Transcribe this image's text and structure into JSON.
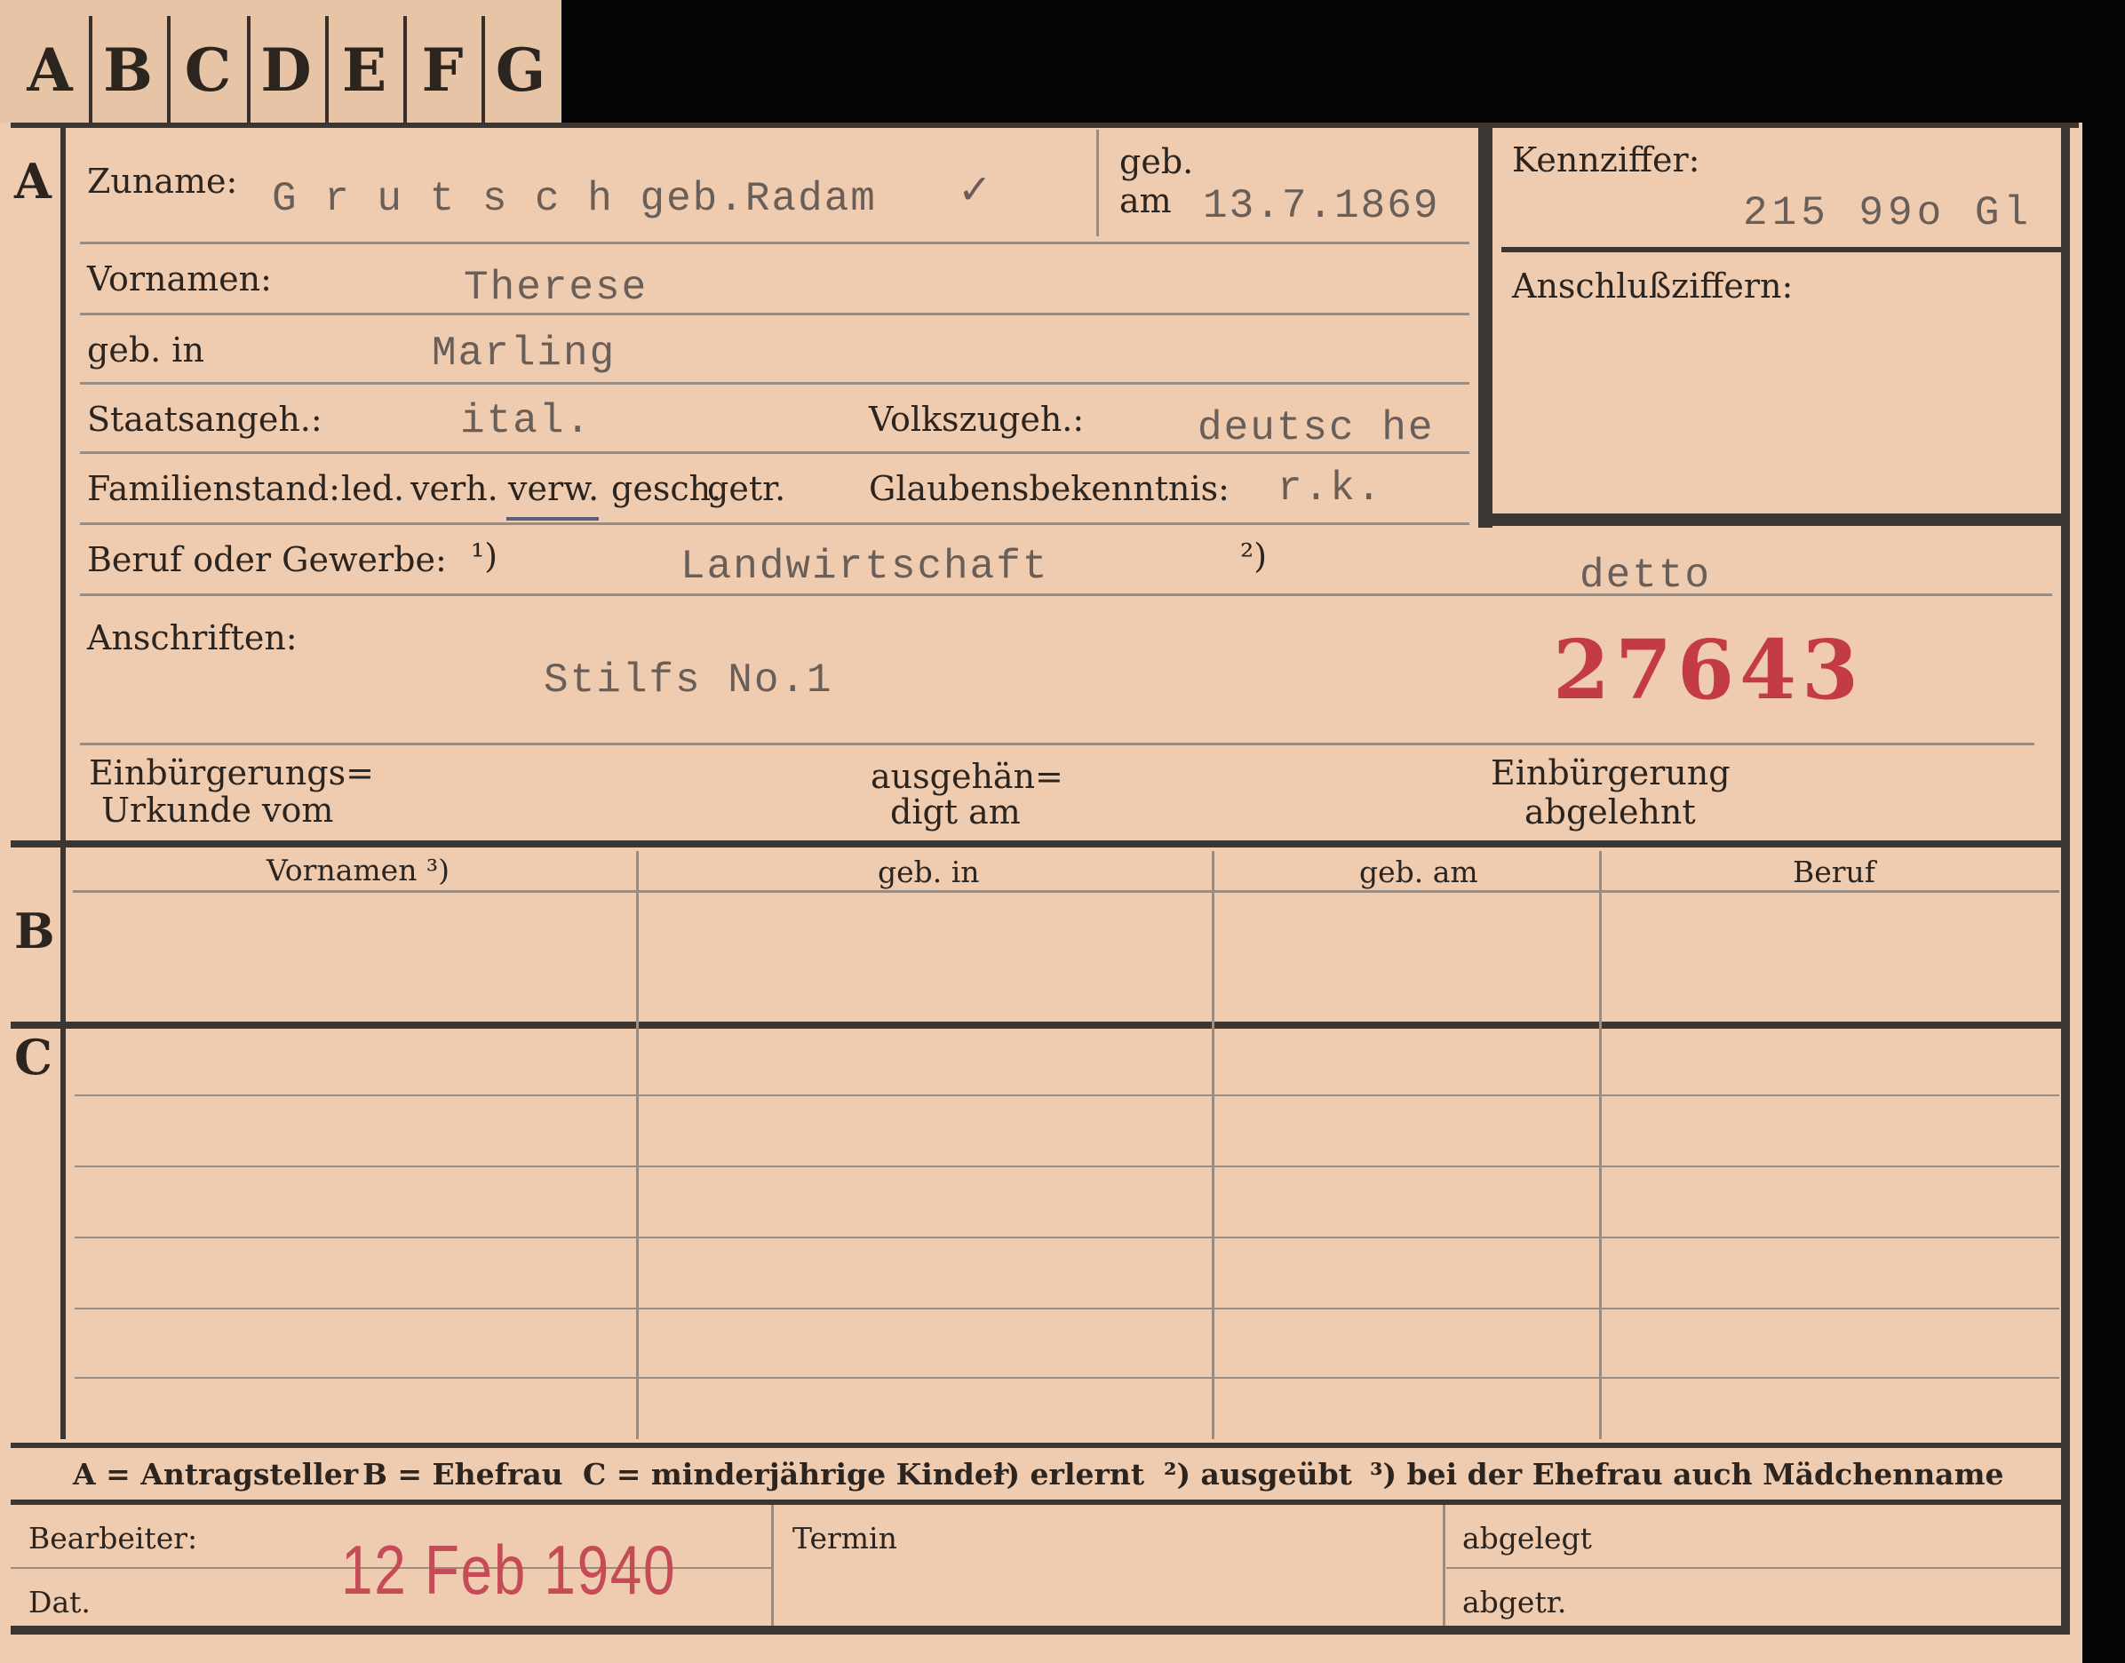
{
  "tabs": [
    "A",
    "B",
    "C",
    "D",
    "E",
    "F",
    "G"
  ],
  "sections": {
    "a": "A",
    "b": "B",
    "c": "C"
  },
  "labels": {
    "zuname": "Zuname:",
    "geb_am_1": "geb.",
    "geb_am_2": "am",
    "vornamen": "Vornamen:",
    "geb_in": "geb. in",
    "staatsangeh": "Staatsangeh.:",
    "volkszugeh": "Volkszugeh.:",
    "familienstand": "Familienstand:",
    "familienstand_options": [
      "led.",
      "verh.",
      "verw.",
      "gesch.",
      "getr."
    ],
    "glaubensbekenntnis": "Glaubensbekenntnis:",
    "beruf": "Beruf oder Gewerbe:",
    "beruf_note1": "¹)",
    "beruf_note2": "²)",
    "anschriften": "Anschriften:",
    "einb_1": "Einbürgerungs=",
    "einb_2": "Urkunde vom",
    "ausgeh_1": "ausgehän=",
    "ausgeh_2": "digt am",
    "abgel_1": "Einbürgerung",
    "abgel_2": "abgelehnt",
    "kennziffer": "Kennziffer:",
    "anschlussziffern": "Anschlußziffern:"
  },
  "values": {
    "zuname": "G r u t s c h  geb.Radam",
    "checkmark": "✓",
    "geb_am": "13.7.1869",
    "vornamen": "Therese",
    "geb_in": "Marling",
    "staatsangeh": "ital.",
    "volkszugeh": "deutsc he",
    "glaubensbekenntnis": "r.k.",
    "beruf1": "Landwirtschaft",
    "beruf2": "detto",
    "anschrift": "Stilfs No.1",
    "stamp_number": "27643",
    "kennziffer": "215 99o  Gl"
  },
  "table": {
    "headers": [
      "Vornamen ³)",
      "geb. in",
      "geb. am",
      "Beruf"
    ]
  },
  "legend": [
    "A = Antragsteller",
    "B = Ehefrau",
    "C = minderjährige Kinder",
    "¹) erlernt",
    "²) ausgeübt",
    "³) bei der Ehefrau auch Mädchenname"
  ],
  "footer": {
    "bearbeiter": "Bearbeiter:",
    "dat": "Dat.",
    "date_stamp": "12 Feb 1940",
    "termin": "Termin",
    "abgelegt": "abgelegt",
    "abgetr": "abgetr."
  },
  "colors": {
    "card": "#efccb0",
    "stamp": "#c23b45",
    "ink": "#2b241f"
  }
}
